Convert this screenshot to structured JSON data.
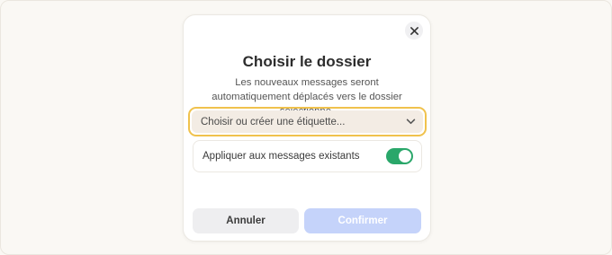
{
  "dialog": {
    "title": "Choisir le dossier",
    "description": "Les nouveaux messages seront automatiquement déplacés vers le dossier sélectionné.",
    "close_icon": "close-icon"
  },
  "folder_select": {
    "placeholder": "Choisir ou créer une étiquette...",
    "icon": "chevron-down-icon",
    "focus_color": "#f0c24d"
  },
  "apply_existing": {
    "label": "Appliquer aux messages existants",
    "enabled": true,
    "color": "#2aa76a"
  },
  "actions": {
    "cancel_label": "Annuler",
    "confirm_label": "Confirmer",
    "confirm_disabled": true,
    "confirm_color": "#c5d3fa"
  }
}
